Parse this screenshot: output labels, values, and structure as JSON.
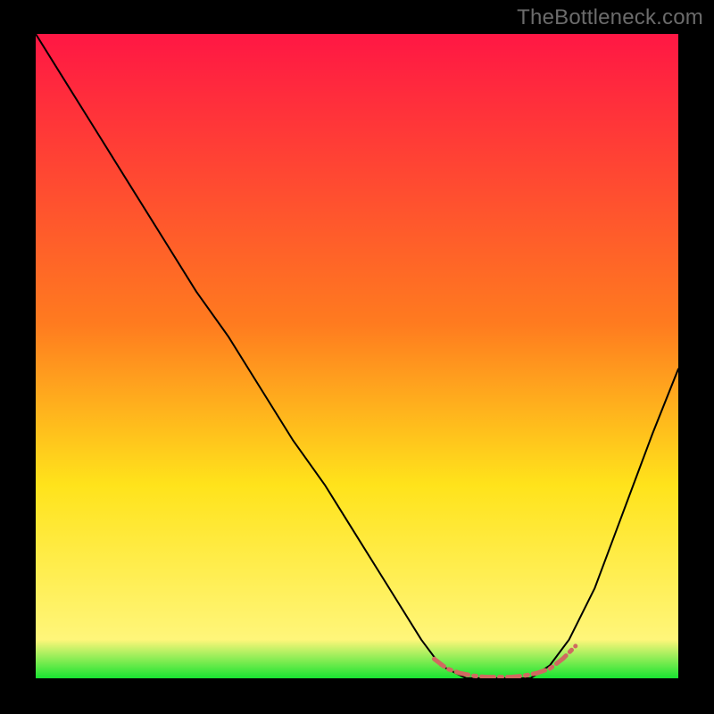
{
  "watermark": "TheBottleneck.com",
  "chart_data": {
    "type": "line",
    "title": "",
    "xlabel": "",
    "ylabel": "",
    "xlim": [
      0,
      100
    ],
    "ylim": [
      0,
      100
    ],
    "grid": false,
    "legend": false,
    "background_gradient": {
      "stops": [
        {
          "y": 100,
          "color": "#ff1744"
        },
        {
          "y": 55,
          "color": "#ff7b1f"
        },
        {
          "y": 30,
          "color": "#ffe31b"
        },
        {
          "y": 6,
          "color": "#fff67a"
        },
        {
          "y": 0,
          "color": "#18e431"
        }
      ]
    },
    "series": [
      {
        "name": "bottleneck-curve",
        "color": "#000000",
        "width": 2,
        "x": [
          0,
          5,
          10,
          15,
          20,
          25,
          30,
          35,
          40,
          45,
          50,
          55,
          60,
          63,
          67,
          70,
          73,
          77,
          80,
          83,
          87,
          90,
          93,
          96,
          100
        ],
        "y": [
          100,
          92,
          84,
          76,
          68,
          60,
          53,
          45,
          37,
          30,
          22,
          14,
          6,
          2,
          0,
          0,
          0,
          0,
          2,
          6,
          14,
          22,
          30,
          38,
          48
        ]
      },
      {
        "name": "highlight-band",
        "color": "#d06a60",
        "style": "dash-dot",
        "width": 5,
        "x": [
          62,
          64,
          66,
          68,
          70,
          72,
          74,
          76,
          78,
          80,
          82,
          84
        ],
        "y": [
          3,
          1.5,
          0.8,
          0.4,
          0.2,
          0.2,
          0.2,
          0.4,
          0.8,
          1.5,
          3,
          5
        ]
      }
    ]
  }
}
